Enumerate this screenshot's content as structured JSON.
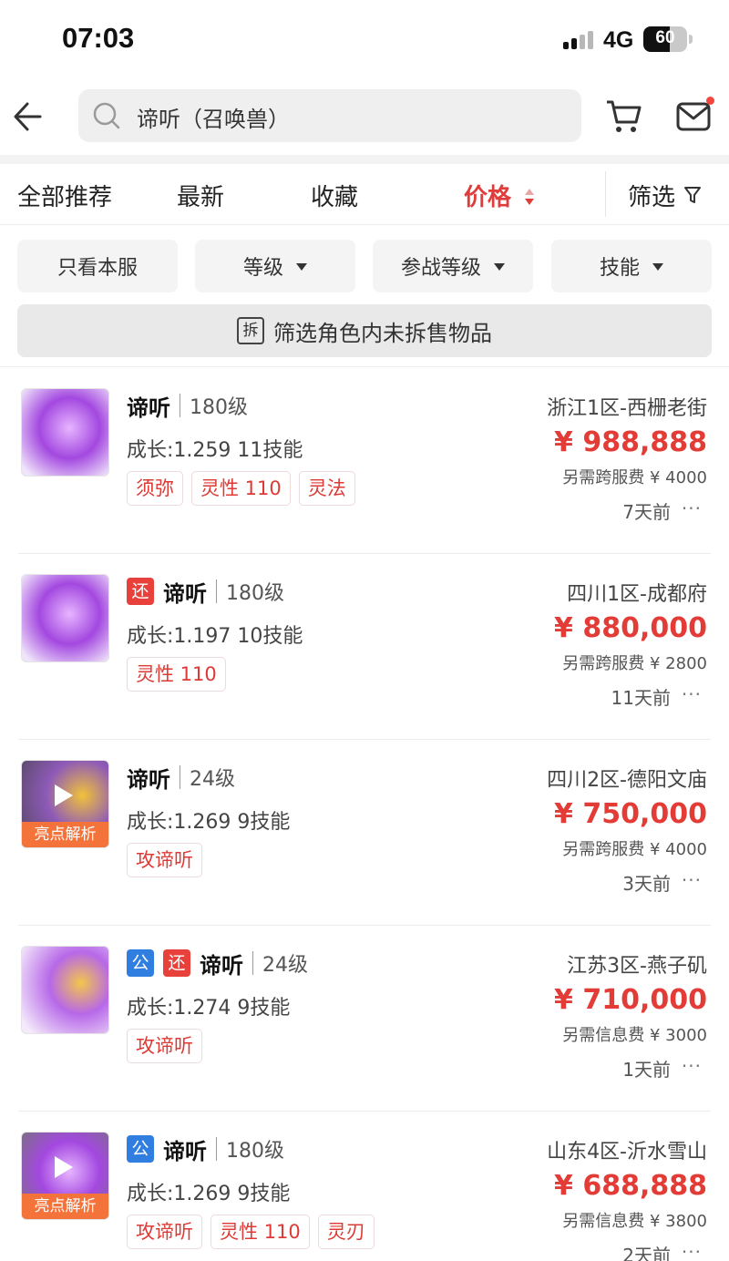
{
  "status_bar": {
    "time": "07:03",
    "network": "4G",
    "battery": "60"
  },
  "search": {
    "query": "谛听（召唤兽）"
  },
  "sort_tabs": [
    {
      "label": "全部推荐"
    },
    {
      "label": "最新"
    },
    {
      "label": "收藏"
    },
    {
      "label": "价格",
      "active": true
    },
    {
      "label": "筛选"
    }
  ],
  "filters": [
    {
      "label": "只看本服"
    },
    {
      "label": "等级"
    },
    {
      "label": "参战等级"
    },
    {
      "label": "技能"
    }
  ],
  "unsold": {
    "icon_text": "拆",
    "label": "筛选角色内未拆售物品"
  },
  "listings": [
    {
      "name": "谛听",
      "level": "180级",
      "growth": "成长:1.259 11技能",
      "tags": [
        "须弥",
        "灵性 110",
        "灵法"
      ],
      "server": "浙江1区-西栅老街",
      "price": "¥ 988,888",
      "fee": "另需跨服费 ¥ 4000",
      "time_ago": "7天前"
    },
    {
      "badges": [
        "还"
      ],
      "name": "谛听",
      "level": "180级",
      "growth": "成长:1.197 10技能",
      "tags": [
        "灵性 110"
      ],
      "server": "四川1区-成都府",
      "price": "¥ 880,000",
      "fee": "另需跨服费 ¥ 2800",
      "time_ago": "11天前"
    },
    {
      "highlight": "亮点解析",
      "name": "谛听",
      "level": "24级",
      "growth": "成长:1.269 9技能",
      "tags": [
        "攻谛听"
      ],
      "server": "四川2区-德阳文庙",
      "price": "¥ 750,000",
      "fee": "另需跨服费 ¥ 4000",
      "time_ago": "3天前"
    },
    {
      "badges": [
        "公",
        "还"
      ],
      "name": "谛听",
      "level": "24级",
      "growth": "成长:1.274 9技能",
      "tags": [
        "攻谛听"
      ],
      "server": "江苏3区-燕子矶",
      "price": "¥ 710,000",
      "fee": "另需信息费 ¥ 3000",
      "time_ago": "1天前"
    },
    {
      "highlight": "亮点解析",
      "badges": [
        "公"
      ],
      "name": "谛听",
      "level": "180级",
      "growth": "成长:1.269 9技能",
      "tags": [
        "攻谛听",
        "灵性 110",
        "灵刃"
      ],
      "server": "山东4区-沂水雪山",
      "price": "¥ 688,888",
      "fee": "另需信息费 ¥ 3800",
      "time_ago": "2天前"
    }
  ],
  "colors": {
    "accent": "#e33b35",
    "public_badge": "#2f7ee0",
    "highlight": "#f3733a"
  }
}
